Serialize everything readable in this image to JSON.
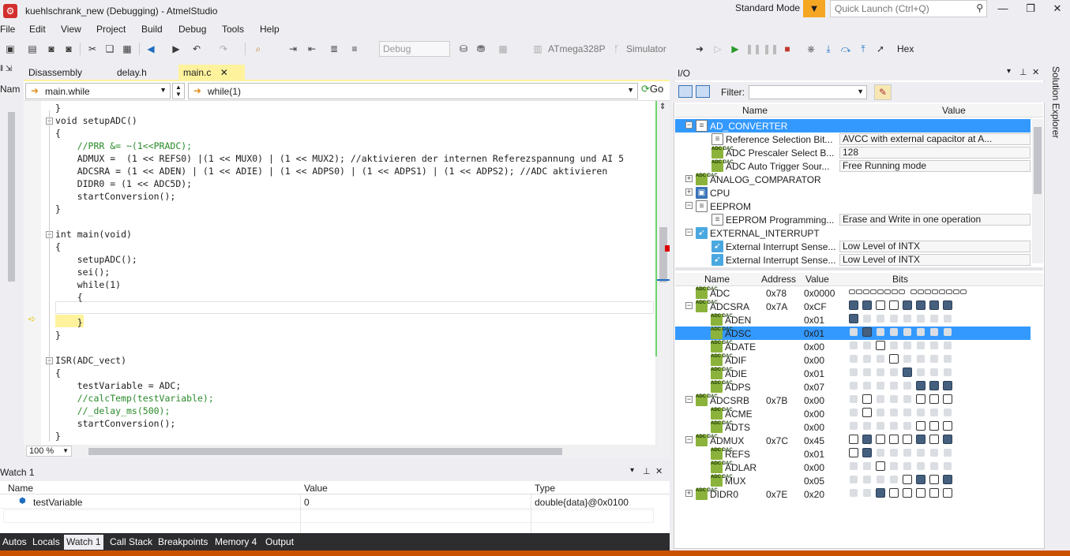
{
  "window": {
    "title": "kuehlschrank_new (Debugging) - AtmelStudio",
    "mode": "Standard Mode",
    "quick_launch_placeholder": "Quick Launch (Ctrl+Q)"
  },
  "menu": [
    "File",
    "Edit",
    "View",
    "Project",
    "Build",
    "Debug",
    "Tools",
    "Help"
  ],
  "toolbar": {
    "config": "Debug",
    "device": "ATmega328P",
    "tool": "Simulator",
    "hex": "Hex"
  },
  "left_strip_label": "Nam",
  "doc_tabs": [
    "Disassembly",
    "delay.h",
    "main.c"
  ],
  "nav": {
    "scope": "main.while",
    "member": "while(1)",
    "go": "Go"
  },
  "code_lines": [
    "}",
    "void setupADC()",
    "{",
    "    //PRR &= ~(1<<PRADC);",
    "    ADMUX =  (1 << REFS0) |(1 << MUX0) | (1 << MUX2); //aktivieren der internen Referezspannung und AI 5",
    "    ADCSRA = (1 << ADEN) | (1 << ADIE) | (1 << ADPS0) | (1 << ADPS1) | (1 << ADPS2); //ADC aktivieren",
    "    DIDR0 = (1 << ADC5D);",
    "    startConversion();",
    "}",
    "",
    "int main(void)",
    "{",
    "    setupADC();",
    "    sei();",
    "    while(1)",
    "    {",
    "",
    "    }",
    "}",
    "",
    "ISR(ADC_vect)",
    "{",
    "    testVariable = ADC;",
    "    //calcTemp(testVariable);",
    "    //_delay_ms(500);",
    "    startConversion();",
    "}"
  ],
  "zoom": "100 %",
  "watch": {
    "title": "Watch 1",
    "columns": [
      "Name",
      "Value",
      "Type"
    ],
    "rows": [
      {
        "name": "testVariable",
        "value": "0",
        "type": "double{data}@0x0100"
      }
    ]
  },
  "bottom_tabs": [
    "Autos",
    "Locals",
    "Watch 1",
    "Call Stack",
    "Breakpoints",
    "Memory 4",
    "Output"
  ],
  "io": {
    "title": "I/O",
    "filter_label": "Filter:",
    "periph_columns": [
      "Name",
      "Value"
    ],
    "peripherals": [
      {
        "name": "AD_CONVERTER",
        "level": 0,
        "expand": "−",
        "icon": "doc",
        "selected": true
      },
      {
        "name": "Reference Selection Bit...",
        "level": 1,
        "icon": "doc",
        "value": "AVCC with external capacitor at A..."
      },
      {
        "name": "ADC  Prescaler Select B...",
        "level": 1,
        "icon": "adc",
        "value": "128"
      },
      {
        "name": "ADC Auto Trigger Sour...",
        "level": 1,
        "icon": "adc",
        "value": "Free Running mode"
      },
      {
        "name": "ANALOG_COMPARATOR",
        "level": 0,
        "expand": "+",
        "icon": "adc"
      },
      {
        "name": "CPU",
        "level": 0,
        "expand": "+",
        "icon": "cpu"
      },
      {
        "name": "EEPROM",
        "level": 0,
        "expand": "−",
        "icon": "doc"
      },
      {
        "name": "EEPROM Programming...",
        "level": 1,
        "icon": "doc",
        "value": "Erase and Write in one operation"
      },
      {
        "name": "EXTERNAL_INTERRUPT",
        "level": 0,
        "expand": "−",
        "icon": "int"
      },
      {
        "name": "External Interrupt Sense...",
        "level": 1,
        "icon": "int",
        "value": "Low Level of INTX"
      },
      {
        "name": "External Interrupt Sense...",
        "level": 1,
        "icon": "int",
        "value": "Low Level of INTX"
      }
    ],
    "reg_columns": [
      "Name",
      "Address",
      "Value",
      "Bits"
    ],
    "registers": [
      {
        "name": "ADC",
        "level": 0,
        "expand": "",
        "address": "0x78",
        "value": "0x0000",
        "bits": "small16"
      },
      {
        "name": "ADCSRA",
        "level": 0,
        "expand": "−",
        "address": "0x7A",
        "value": "0xCF",
        "bits": "11001111"
      },
      {
        "name": "ADEN",
        "level": 1,
        "address": "",
        "value": "0x01",
        "bits": "1-------"
      },
      {
        "name": "ADSC",
        "level": 1,
        "address": "",
        "value": "0x01",
        "bits": "-1------",
        "selected": true
      },
      {
        "name": "ADATE",
        "level": 1,
        "address": "",
        "value": "0x00",
        "bits": "--0-----"
      },
      {
        "name": "ADIF",
        "level": 1,
        "address": "",
        "value": "0x00",
        "bits": "---0----"
      },
      {
        "name": "ADIE",
        "level": 1,
        "address": "",
        "value": "0x01",
        "bits": "----1---"
      },
      {
        "name": "ADPS",
        "level": 1,
        "address": "",
        "value": "0x07",
        "bits": "-----111"
      },
      {
        "name": "ADCSRB",
        "level": 0,
        "expand": "−",
        "address": "0x7B",
        "value": "0x00",
        "bits": "-0---000"
      },
      {
        "name": "ACME",
        "level": 1,
        "address": "",
        "value": "0x00",
        "bits": "-0------"
      },
      {
        "name": "ADTS",
        "level": 1,
        "address": "",
        "value": "0x00",
        "bits": "-----000"
      },
      {
        "name": "ADMUX",
        "level": 0,
        "expand": "−",
        "address": "0x7C",
        "value": "0x45",
        "bits": "01000101"
      },
      {
        "name": "REFS",
        "level": 1,
        "address": "",
        "value": "0x01",
        "bits": "01------"
      },
      {
        "name": "ADLAR",
        "level": 1,
        "address": "",
        "value": "0x00",
        "bits": "--0-----"
      },
      {
        "name": "MUX",
        "level": 1,
        "address": "",
        "value": "0x05",
        "bits": "----0101"
      },
      {
        "name": "DIDR0",
        "level": 0,
        "expand": "+",
        "address": "0x7E",
        "value": "0x20",
        "bits": "--100000"
      }
    ]
  },
  "solution_explorer": "Solution Explorer",
  "colors": {
    "accent": "#fff29d",
    "status": "#ca5100",
    "selection": "#3399ff",
    "bit_set": "#45607f"
  }
}
